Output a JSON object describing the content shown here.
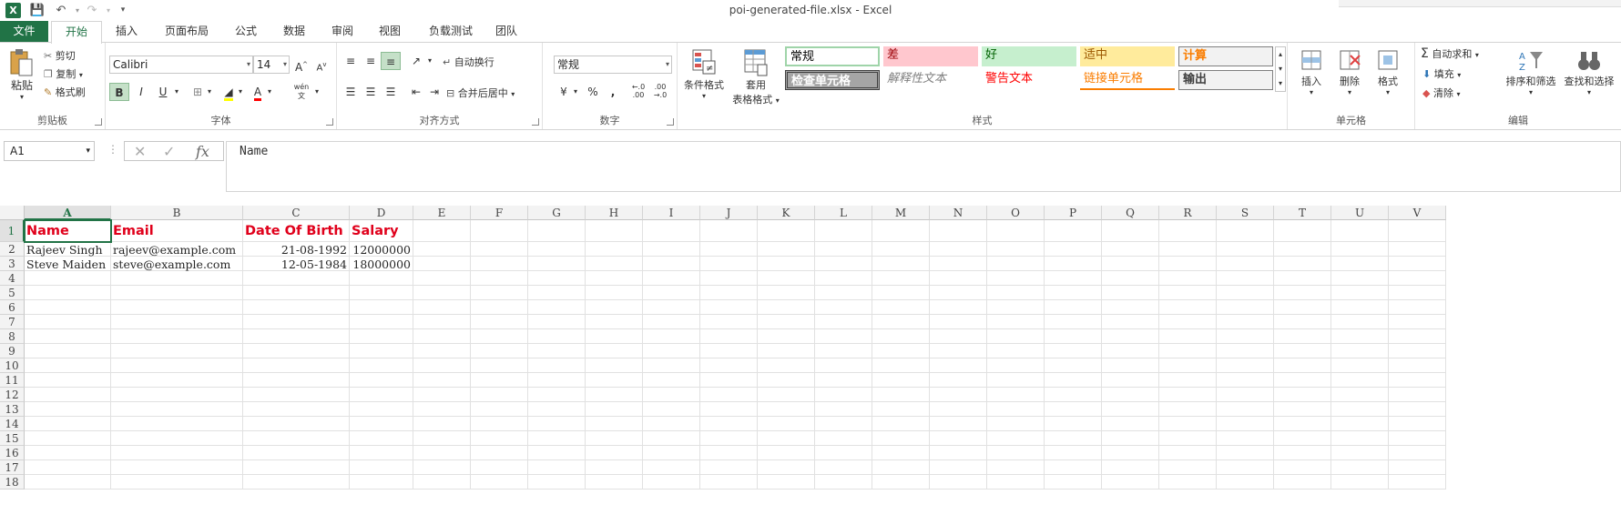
{
  "window": {
    "title": "poi-generated-file.xlsx - Excel"
  },
  "tabs": {
    "file": "文件",
    "home": "开始",
    "items": [
      "插入",
      "页面布局",
      "公式",
      "数据",
      "审阅",
      "视图",
      "负载测试",
      "团队"
    ]
  },
  "clipboard": {
    "paste": "粘贴",
    "cut": "剪切",
    "copy": "复制",
    "format_painter": "格式刷",
    "label": "剪贴板"
  },
  "font": {
    "name": "Calibri",
    "size": "14",
    "bold": "B",
    "italic": "I",
    "underline": "U",
    "label": "字体",
    "phonetic": "wén"
  },
  "alignment": {
    "wrap": "自动换行",
    "merge": "合并后居中",
    "label": "对齐方式"
  },
  "number": {
    "format": "常规",
    "percent": "%",
    "comma": ",",
    "label": "数字"
  },
  "styles": {
    "conditional": "条件格式",
    "table_format_1": "套用",
    "table_format_2": "表格格式",
    "gallery": [
      {
        "text": "常规",
        "bg": "#ffffff",
        "fg": "#000000"
      },
      {
        "text": "差",
        "bg": "#ffc7ce",
        "fg": "#9c0006"
      },
      {
        "text": "好",
        "bg": "#c6efce",
        "fg": "#006100"
      },
      {
        "text": "适中",
        "bg": "#ffeb9c",
        "fg": "#9c5700"
      },
      {
        "text": "计算",
        "bg": "#f2f2f2",
        "fg": "#fa7d00"
      },
      {
        "text": "检查单元格",
        "bg": "#a5a5a5",
        "fg": "#ffffff"
      },
      {
        "text": "解释性文本",
        "bg": "#ffffff",
        "fg": "#7f7f7f"
      },
      {
        "text": "警告文本",
        "bg": "#ffffff",
        "fg": "#ff0000"
      },
      {
        "text": "链接单元格",
        "bg": "#ffffff",
        "fg": "#fa7d00"
      },
      {
        "text": "输出",
        "bg": "#f2f2f2",
        "fg": "#3f3f3f"
      }
    ],
    "label": "样式"
  },
  "cells": {
    "insert": "插入",
    "delete": "删除",
    "format": "格式",
    "label": "单元格"
  },
  "editing": {
    "autosum": "自动求和",
    "fill": "填充",
    "clear": "清除",
    "sort": "排序和筛选",
    "find": "查找和选择",
    "label": "编辑"
  },
  "formula_bar": {
    "name_box": "A1",
    "fx": "fx",
    "value": "Name"
  },
  "sheet": {
    "columns": [
      "A",
      "B",
      "C",
      "D",
      "E",
      "F",
      "G",
      "H",
      "I",
      "J",
      "K",
      "L",
      "M",
      "N",
      "O",
      "P",
      "Q",
      "R",
      "S",
      "T",
      "U",
      "V"
    ],
    "rows": [
      "1",
      "2",
      "3",
      "4",
      "5",
      "6",
      "7",
      "8",
      "9",
      "10",
      "11",
      "12",
      "13",
      "14",
      "15",
      "16",
      "17",
      "18"
    ],
    "data": [
      [
        "Name",
        "Email",
        "Date Of Birth",
        "Salary"
      ],
      [
        "Rajeev Singh",
        "rajeev@example.com",
        "21-08-1992",
        "12000000"
      ],
      [
        "Steve Maiden",
        "steve@example.com",
        "12-05-1984",
        "18000000"
      ]
    ]
  }
}
